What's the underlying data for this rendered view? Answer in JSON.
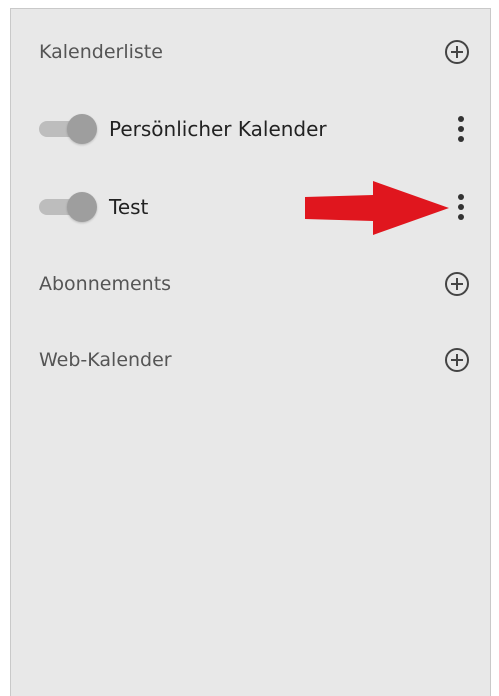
{
  "calendar_list": {
    "header": "Kalenderliste",
    "add_icon": "plus-circle-icon",
    "items": [
      {
        "label": "Persönlicher Kalender",
        "enabled": true,
        "menu_icon": "kebab-menu-icon"
      },
      {
        "label": "Test",
        "enabled": true,
        "menu_icon": "kebab-menu-icon"
      }
    ]
  },
  "subscriptions": {
    "header": "Abonnements",
    "add_icon": "plus-circle-icon"
  },
  "web_calendars": {
    "header": "Web-Kalender",
    "add_icon": "plus-circle-icon"
  },
  "annotation": {
    "icon": "red-arrow-icon",
    "color": "#e0161e"
  },
  "colors": {
    "panel_background": "#e8e8e8",
    "toggle_track": "#bdbdbd",
    "toggle_knob": "#9e9e9e",
    "section_text": "#555555",
    "item_text": "#222222"
  }
}
